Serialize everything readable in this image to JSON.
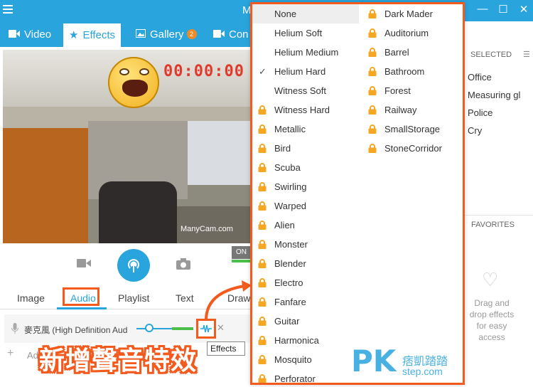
{
  "app": {
    "title": "M"
  },
  "window_controls": {
    "minimize": "—",
    "maximize": "☐",
    "close": "✕"
  },
  "tabs": [
    {
      "label": "Video",
      "icon": "video-camera-icon"
    },
    {
      "label": "Effects",
      "icon": "star-icon",
      "active": true
    },
    {
      "label": "Gallery",
      "icon": "image-icon",
      "badge": "2"
    },
    {
      "label": "Con",
      "icon": "video-camera-icon"
    }
  ],
  "preview": {
    "timer": "00:00:00",
    "watermark": "ManyCam.com",
    "on_label": "ON"
  },
  "subtabs": [
    "Image",
    "Audio",
    "Playlist",
    "Text",
    "Draw"
  ],
  "audio": {
    "device_name": "麥克風 (High Definition Aud",
    "add_label": "Add",
    "tooltip": "Effects"
  },
  "caption": "新增聲音特效",
  "right_panel": {
    "selected_header": "SELECTED",
    "selected_items": [
      "Office",
      "Measuring gl",
      "Police",
      "Cry"
    ],
    "favorites_header": "FAVORITES",
    "favorites_hint": "Drag and drop effects for easy access"
  },
  "effects_menu": {
    "left": [
      {
        "label": "None",
        "locked": false,
        "highlighted": true
      },
      {
        "label": "Helium Soft",
        "locked": false
      },
      {
        "label": "Helium Medium",
        "locked": false
      },
      {
        "label": "Helium Hard",
        "locked": false,
        "checked": true
      },
      {
        "label": "Witness Soft",
        "locked": false
      },
      {
        "label": "Witness Hard",
        "locked": true
      },
      {
        "label": "Metallic",
        "locked": true
      },
      {
        "label": "Bird",
        "locked": true
      },
      {
        "label": "Scuba",
        "locked": true
      },
      {
        "label": "Swirling",
        "locked": true
      },
      {
        "label": "Warped",
        "locked": true
      },
      {
        "label": "Alien",
        "locked": true
      },
      {
        "label": "Monster",
        "locked": true
      },
      {
        "label": "Blender",
        "locked": true
      },
      {
        "label": "Electro",
        "locked": true
      },
      {
        "label": "Fanfare",
        "locked": true
      },
      {
        "label": "Guitar",
        "locked": true
      },
      {
        "label": "Harmonica",
        "locked": true
      },
      {
        "label": "Mosquito",
        "locked": true
      },
      {
        "label": "Perforator",
        "locked": true
      }
    ],
    "right": [
      {
        "label": "Dark Mader",
        "locked": true
      },
      {
        "label": "Auditorium",
        "locked": true
      },
      {
        "label": "Barrel",
        "locked": true
      },
      {
        "label": "Bathroom",
        "locked": true
      },
      {
        "label": "Forest",
        "locked": true
      },
      {
        "label": "Railway",
        "locked": true
      },
      {
        "label": "SmallStorage",
        "locked": true
      },
      {
        "label": "StoneCorridor",
        "locked": true
      }
    ]
  },
  "logo": {
    "mark": "PK",
    "cn": "痞凱踏踏",
    "site": "step.com"
  },
  "colors": {
    "accent": "#2aa4dd",
    "highlight": "#f25a1e",
    "lock": "#f5a623",
    "badge": "#f08a24"
  }
}
